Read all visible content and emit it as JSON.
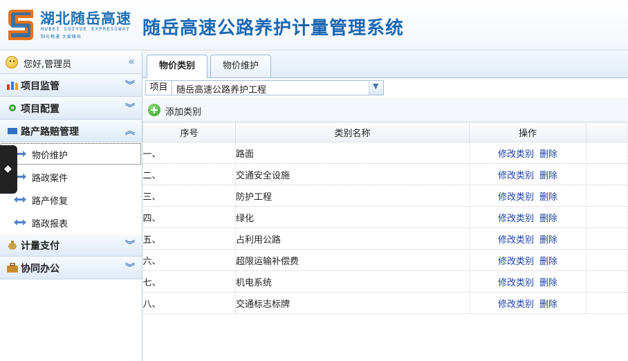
{
  "header": {
    "logo_cn": "湖北随岳高速",
    "logo_en": "HUBEI SUIYUE EXPRESSWAY",
    "logo_slogan": "阳光畅通  大爱随岳",
    "system_title": "随岳高速公路养护计量管理系统",
    "colors": {
      "brand_blue": "#1a67b3",
      "logo_orange": "#e8731c"
    }
  },
  "sidebar": {
    "greeting": "您好,管理员",
    "collapse_icon": "double-chevron-left-icon",
    "menus": [
      {
        "label": "项目监管",
        "icon": "bar-chart-icon",
        "state": "collapsed"
      },
      {
        "label": "项目配置",
        "icon": "gear-icon",
        "state": "collapsed"
      },
      {
        "label": "路产路赔管理",
        "icon": "road-icon",
        "state": "expanded",
        "items": [
          "物价维护",
          "路政案件",
          "路产修复",
          "路政报表"
        ],
        "active_item": "物价维护"
      },
      {
        "label": "计量支付",
        "icon": "money-bag-icon",
        "state": "collapsed"
      },
      {
        "label": "协同办公",
        "icon": "briefcase-icon",
        "state": "collapsed"
      }
    ]
  },
  "tabs": [
    {
      "label": "物价类别",
      "active": true
    },
    {
      "label": "物价维护",
      "active": false
    }
  ],
  "project": {
    "label": "项目",
    "selected": "随岳高速公路养护工程"
  },
  "toolbar": {
    "add_label": "添加类别"
  },
  "table": {
    "columns": [
      "序号",
      "类别名称",
      "操作"
    ],
    "rows": [
      {
        "no": "一、",
        "name": "路面"
      },
      {
        "no": "二、",
        "name": "交通安全设施"
      },
      {
        "no": "三、",
        "name": "防护工程"
      },
      {
        "no": "四、",
        "name": "绿化"
      },
      {
        "no": "五、",
        "name": "占利用公路"
      },
      {
        "no": "六、",
        "name": "超限运输补偿费"
      },
      {
        "no": "七、",
        "name": "机电系统"
      },
      {
        "no": "八、",
        "name": "交通标志标牌"
      }
    ],
    "actions": {
      "edit": "修改类别",
      "delete": "删除"
    }
  }
}
